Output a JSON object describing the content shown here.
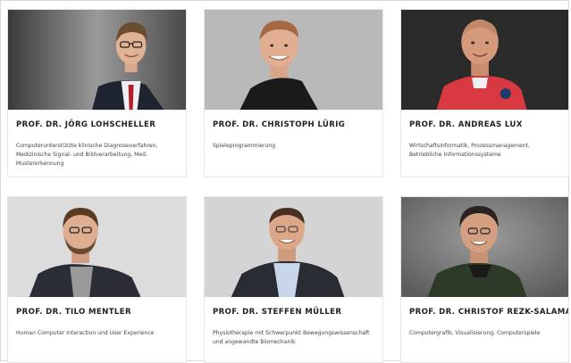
{
  "profiles": [
    {
      "name": "PROF. DR. JÖRG LOHSCHELLER",
      "description": "Computerunterstützte klinische Diagnoseverfahren, Medizinische Signal- und Bildverarbeitung, Med. Mustererkennung"
    },
    {
      "name": "PROF. DR. CHRISTOPH LÜRIG",
      "description": "Spieleprogrammierung"
    },
    {
      "name": "PROF. DR. ANDREAS LUX",
      "description": "Wirtschaftsinformatik, Prozessmanagement, Betriebliche Informationssysteme"
    },
    {
      "name": "PROF. DR. TILO MENTLER",
      "description": "Human Computer Interaction und User Experience"
    },
    {
      "name": "PROF. DR. STEFFEN MÜLLER",
      "description": "Physiotherapie mit Schwerpunkt Bewegungswissenschaft und angewandte Biomechanik"
    },
    {
      "name": "PROF. DR. CHRISTOF REZK-SALAMA",
      "description": "Computergrafik, Visualisierung, Computerspiele"
    }
  ],
  "colors": {
    "card_border": "#e6e6e6",
    "name_text": "#222222",
    "desc_text": "#444444"
  }
}
